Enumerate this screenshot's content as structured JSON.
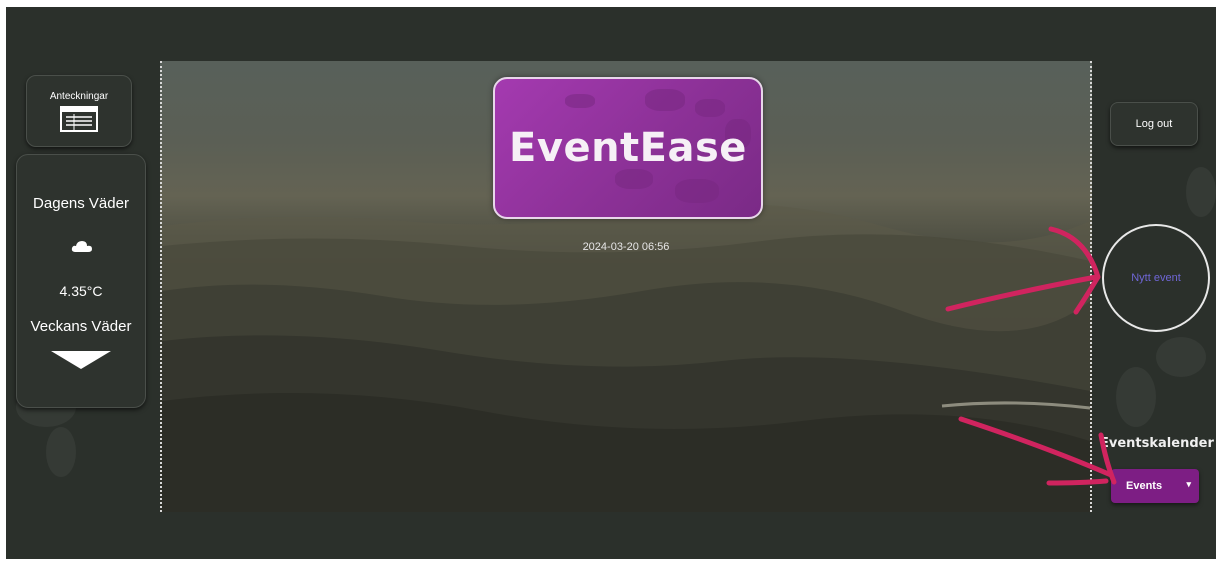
{
  "brand": {
    "name": "EventEase",
    "accent_color": "#8c3197"
  },
  "header": {
    "datetime": "2024-03-20 06:56"
  },
  "sidebar": {
    "notes_label": "Anteckningar",
    "notes_icon": "notepad-icon",
    "weather": {
      "today_title": "Dagens Väder",
      "condition_icon": "cloud-icon",
      "temperature": "4.35°C",
      "week_title": "Veckans Väder",
      "expand_icon": "chevron-down-icon"
    }
  },
  "account": {
    "logout_label": "Log out"
  },
  "actions": {
    "new_event_label": "Nytt event"
  },
  "calendar": {
    "title": "Eventskalender",
    "select_value": "Events"
  },
  "colors": {
    "background": "#2b302b",
    "annotation": "#d0245f",
    "new_event_text": "#6f66d6"
  }
}
